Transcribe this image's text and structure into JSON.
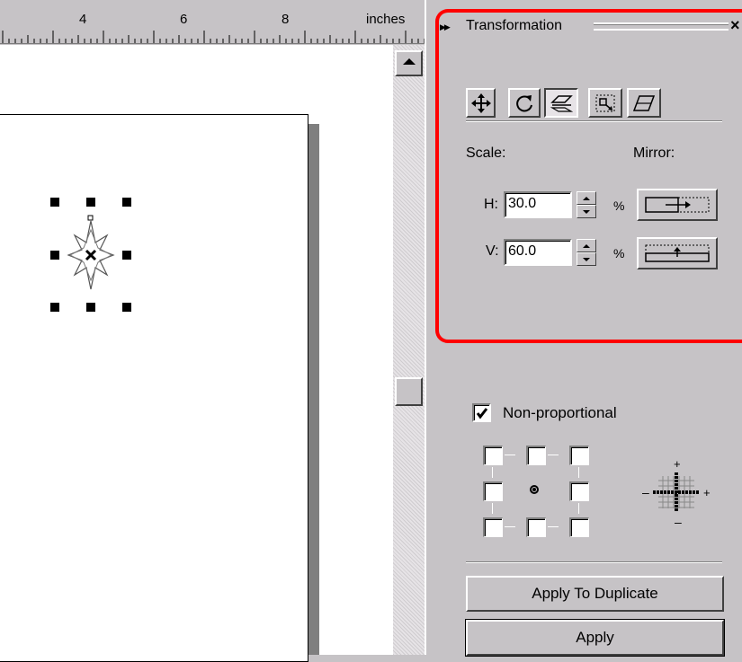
{
  "ruler": {
    "labels": [
      "4",
      "6",
      "8"
    ],
    "unit": "inches"
  },
  "docker": {
    "title": "Transformation",
    "close_glyph": "×",
    "tools": [
      {
        "name": "position-icon"
      },
      {
        "name": "rotate-icon"
      },
      {
        "name": "scale-mirror-icon",
        "active": true
      },
      {
        "name": "size-icon"
      },
      {
        "name": "skew-icon"
      }
    ],
    "scale_label": "Scale:",
    "mirror_label": "Mirror:",
    "h_label": "H:",
    "h_value": "30.0",
    "v_label": "V:",
    "v_value": "60.0",
    "percent": "%",
    "nonproportional_label": "Non-proportional",
    "nonproportional_checked": true,
    "anchor_selected": "center",
    "apply_duplicate_label": "Apply To Duplicate",
    "apply_label": "Apply"
  },
  "colors": {
    "highlight": "#ff0000",
    "panel": "#c6c3c6"
  }
}
